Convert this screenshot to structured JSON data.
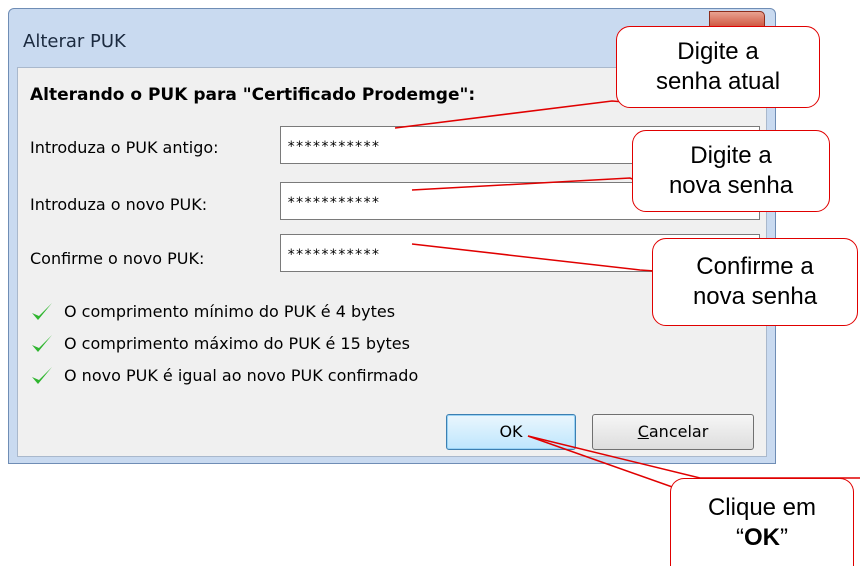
{
  "dialog": {
    "title": "Alterar PUK",
    "heading": "Alterando o PUK para \"Certificado Prodemge\":",
    "fields": [
      {
        "label": "Introduza o PUK antigo:",
        "value": "***********"
      },
      {
        "label": "Introduza o novo PUK:",
        "value": "***********"
      },
      {
        "label": "Confirme o novo PUK:",
        "value": "***********"
      }
    ],
    "checks": [
      "O comprimento mínimo do PUK é 4 bytes",
      "O comprimento máximo do PUK é 15 bytes",
      "O novo PUK é igual ao novo PUK confirmado"
    ],
    "ok_label": "OK",
    "cancel_first": "C",
    "cancel_rest": "ancelar"
  },
  "callouts": {
    "current": "Digite a\nsenha atual",
    "new": "Digite a\nnova senha",
    "confirm": "Confirme a\nnova senha",
    "click_prefix": "Clique em\n“",
    "click_bold": "OK",
    "click_suffix": "”"
  },
  "colors": {
    "callout_border": "#e00000",
    "check_green": "#2fb52f",
    "title_bar": "#c9daf0"
  }
}
